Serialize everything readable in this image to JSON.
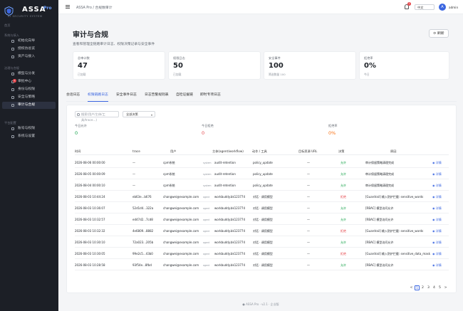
{
  "brand": {
    "name": "ASSA",
    "pro": "Pro",
    "tagline": "AI SECURITY SYSTEM"
  },
  "sidebar": {
    "groups": [
      {
        "label": "首页"
      },
      {
        "label": "系统与接入",
        "items": [
          {
            "label": "初始化向导"
          },
          {
            "label": "授权仿总览"
          },
          {
            "label": "资产与接入"
          }
        ]
      },
      {
        "label": "治理与合规",
        "items": [
          {
            "label": "模型与分发"
          },
          {
            "label": "审批中心",
            "badge": "1"
          },
          {
            "label": "身份与权限"
          },
          {
            "label": "安全与策略"
          },
          {
            "label": "审计与合规",
            "active": true
          }
        ]
      },
      {
        "label": "平台配置",
        "items": [
          {
            "label": "账号与权限"
          },
          {
            "label": "系统与设置"
          }
        ]
      }
    ]
  },
  "topbar": {
    "breadcrumb": "ASSA Pro / 合规数审计",
    "notification_count": "1",
    "language": "中文",
    "avatar_letter": "A",
    "username": "admin"
  },
  "page": {
    "title": "审计与合规",
    "subtitle": "查看和管理全链路审计日志、权限决策记录与安全事件",
    "refresh_label": "刷新"
  },
  "stats": [
    {
      "label": "总审计数",
      "value": "47",
      "sub": "已加载"
    },
    {
      "label": "权限日志",
      "value": "50",
      "sub": "已加载"
    },
    {
      "label": "安全事件",
      "value": "100",
      "sub": "筛选数量 100"
    },
    {
      "label": "拒绝率",
      "value": "0%",
      "sub": "今日"
    }
  ],
  "tabs": [
    {
      "label": "会话日志"
    },
    {
      "label": "权限链路日志",
      "active": true
    },
    {
      "label": "安全事件日志"
    },
    {
      "label": "日志告警规则表"
    },
    {
      "label": "自检证据链"
    },
    {
      "label": "即时专项日志"
    }
  ],
  "filters": {
    "search_placeholder": "搜索(用户/主体/工具/trace...)",
    "decision_select": "全部决策"
  },
  "mini_stats": [
    {
      "label": "今日允许",
      "value": "0",
      "color": "#16a34a"
    },
    {
      "label": "今日拒绝",
      "value": "0",
      "color": "#e5484d"
    },
    {
      "label": "拒绝率",
      "value": "0%",
      "color": "#f97316"
    }
  ],
  "table": {
    "columns": [
      "时间",
      "trace",
      "用户",
      "主体(agent/workflow)",
      "动作 / 工具",
      "目标资源 URL",
      "决策",
      "原因"
    ],
    "detail_label": "详情",
    "rows": [
      {
        "time": "2026-08-06 00:00:00",
        "trace": "—",
        "user": "cpm系统",
        "actor_tag": "system",
        "actor": "audit-retention",
        "action": "policy_update",
        "url": "—",
        "decision": "允许",
        "allow": true,
        "reason": "审计保留策略清理完成"
      },
      {
        "time": "2026-08-05 00:00:09",
        "trace": "—",
        "user": "cpm系统",
        "actor_tag": "system",
        "actor": "audit-retention",
        "action": "policy_update",
        "url": "—",
        "decision": "允许",
        "allow": true,
        "reason": "审计保留策略清理完成"
      },
      {
        "time": "2026-08-04 00:00:10",
        "trace": "—",
        "user": "cpm系统",
        "actor_tag": "system",
        "actor": "audit-retention",
        "action": "policy_update",
        "url": "—",
        "decision": "允许",
        "allow": true,
        "reason": "审计保留策略清理完成"
      },
      {
        "time": "2026-08-03 10:44:24",
        "trace": "eb63e...b676",
        "user": "changwei@example.com",
        "actor_tag": "agent",
        "actor": "workbuddy.bk123774",
        "action": "对话 · 调用模型",
        "url": "—",
        "decision": "拒绝",
        "allow": false,
        "reason": "[Guardrail] 输入防护拦截: sensitive_words"
      },
      {
        "time": "2026-08-03 10:36:07",
        "trace": "52d1d4...322a",
        "user": "changwei@example.com",
        "actor_tag": "agent",
        "actor": "workbuddy.bk123774",
        "action": "对话 · 调用模型",
        "url": "—",
        "decision": "允许",
        "allow": true,
        "reason": "[RBAC] 模型访问允许"
      },
      {
        "time": "2026-08-03 10:32:57",
        "trace": "ed47d2...7cd8",
        "user": "changwei@example.com",
        "actor_tag": "agent",
        "actor": "workbuddy.bk123774",
        "action": "对话 · 调用模型",
        "url": "—",
        "decision": "允许",
        "allow": true,
        "reason": "[RBAC] 模型访问允许"
      },
      {
        "time": "2026-08-03 10:32:32",
        "trace": "4e6809...8882",
        "user": "changwei@example.com",
        "actor_tag": "agent",
        "actor": "workbuddy.bk123774",
        "action": "对话 · 调用模型",
        "url": "—",
        "decision": "拒绝",
        "allow": false,
        "reason": "[Guardrail] 输入防护拦截: sensitive_words"
      },
      {
        "time": "2026-08-03 10:30:10",
        "trace": "72a023...205b",
        "user": "changwei@example.com",
        "actor_tag": "agent",
        "actor": "workbuddy.bk123774",
        "action": "对话 · 调用模型",
        "url": "—",
        "decision": "允许",
        "allow": true,
        "reason": "[RBAC] 模型访问允许"
      },
      {
        "time": "2026-08-03 10:30:05",
        "trace": "99e2c5...43b0",
        "user": "changwei@example.com",
        "actor_tag": "agent",
        "actor": "workbuddy.bk123774",
        "action": "对话 · 调用模型",
        "url": "—",
        "decision": "拒绝",
        "allow": false,
        "reason": "[Guardrail] 输入防护拦截: sensitive_data_mask"
      },
      {
        "time": "2026-08-03 10:28:58",
        "trace": "93f54e...8fbd",
        "user": "changwei@example.com",
        "actor_tag": "agent",
        "actor": "workbuddy.bk123774",
        "action": "对话 · 调用模型",
        "url": "—",
        "decision": "允许",
        "allow": true,
        "reason": "[RBAC] 模型访问允许"
      }
    ]
  },
  "pagination": {
    "prev": "<",
    "pages": [
      "1",
      "2",
      "3",
      "4",
      "5"
    ],
    "next": ">"
  },
  "footer": "● ASSA Pro · v2.1 · 企业版"
}
